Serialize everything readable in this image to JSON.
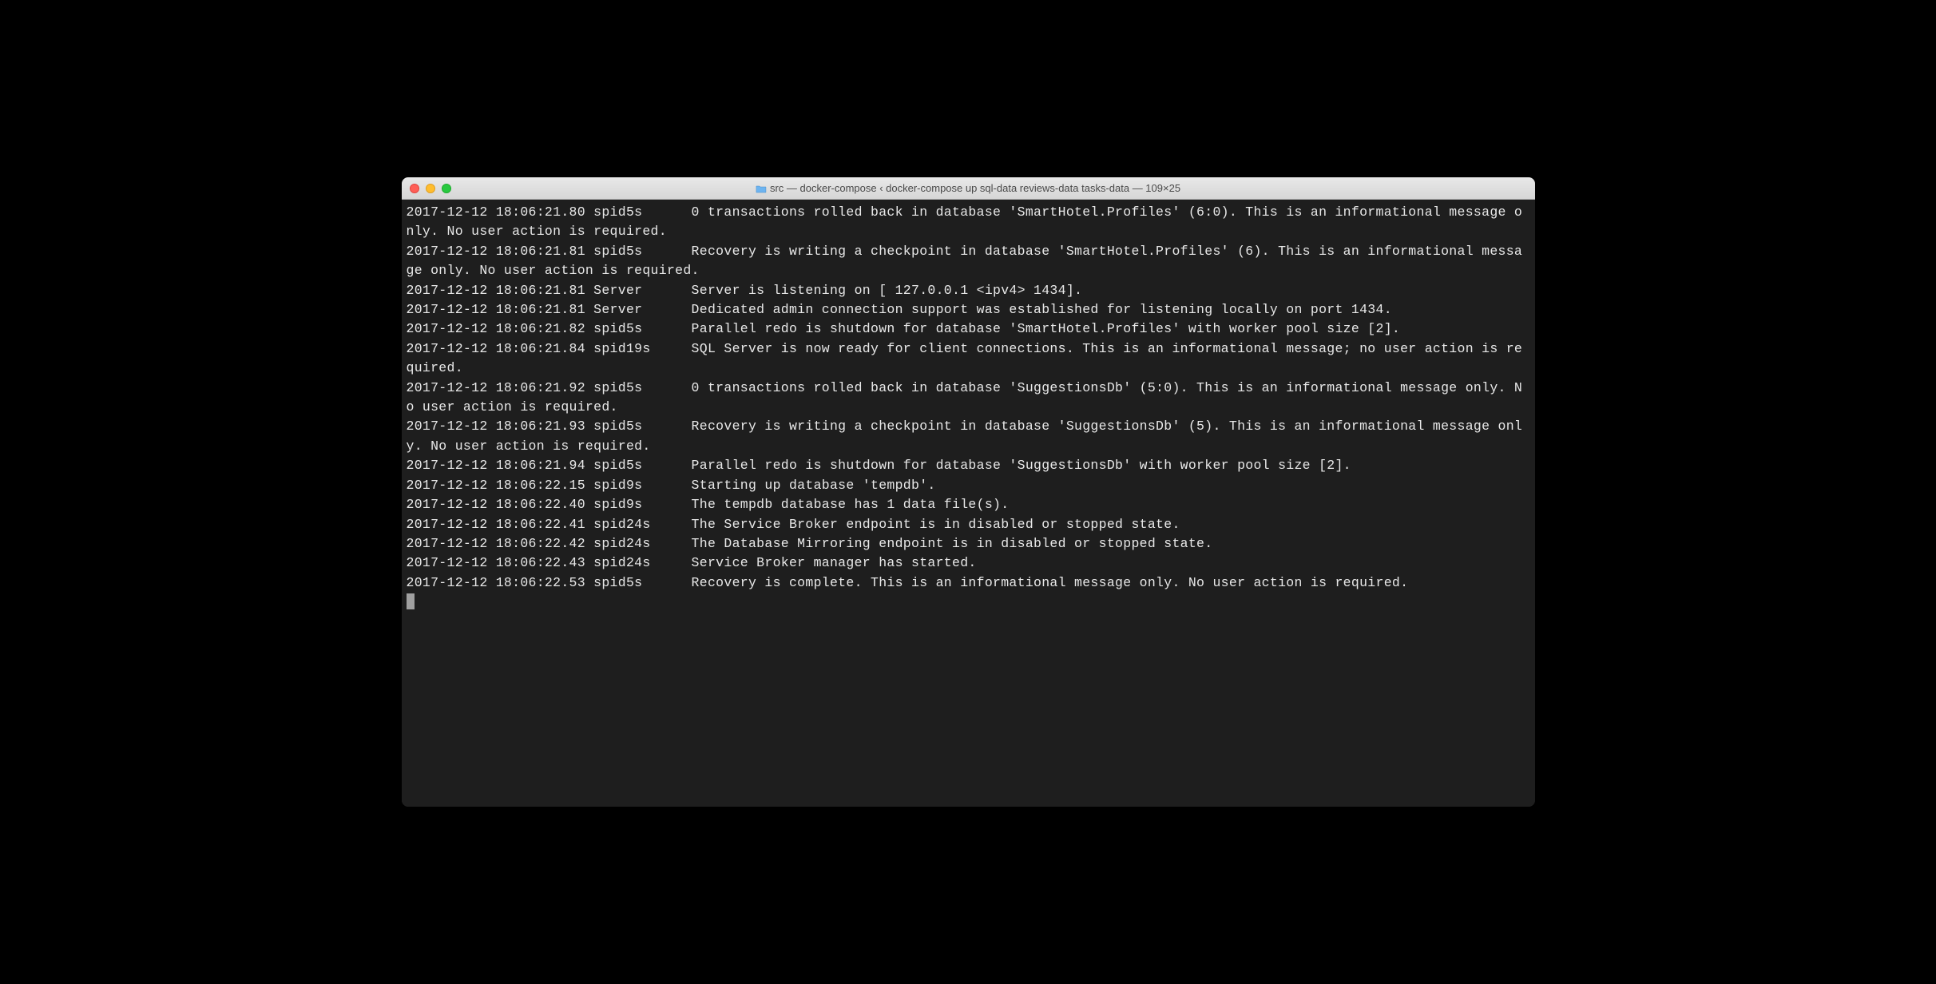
{
  "window": {
    "title": "src — docker-compose ‹ docker-compose up sql-data reviews-data tasks-data — 109×25"
  },
  "log_lines": [
    "2017-12-12 18:06:21.80 spid5s      0 transactions rolled back in database 'SmartHotel.Profiles' (6:0). This is an informational message only. No user action is required.",
    "2017-12-12 18:06:21.81 spid5s      Recovery is writing a checkpoint in database 'SmartHotel.Profiles' (6). This is an informational message only. No user action is required.",
    "2017-12-12 18:06:21.81 Server      Server is listening on [ 127.0.0.1 <ipv4> 1434].",
    "2017-12-12 18:06:21.81 Server      Dedicated admin connection support was established for listening locally on port 1434.",
    "2017-12-12 18:06:21.82 spid5s      Parallel redo is shutdown for database 'SmartHotel.Profiles' with worker pool size [2].",
    "2017-12-12 18:06:21.84 spid19s     SQL Server is now ready for client connections. This is an informational message; no user action is required.",
    "2017-12-12 18:06:21.92 spid5s      0 transactions rolled back in database 'SuggestionsDb' (5:0). This is an informational message only. No user action is required.",
    "2017-12-12 18:06:21.93 spid5s      Recovery is writing a checkpoint in database 'SuggestionsDb' (5). This is an informational message only. No user action is required.",
    "2017-12-12 18:06:21.94 spid5s      Parallel redo is shutdown for database 'SuggestionsDb' with worker pool size [2].",
    "2017-12-12 18:06:22.15 spid9s      Starting up database 'tempdb'.",
    "2017-12-12 18:06:22.40 spid9s      The tempdb database has 1 data file(s).",
    "2017-12-12 18:06:22.41 spid24s     The Service Broker endpoint is in disabled or stopped state.",
    "2017-12-12 18:06:22.42 spid24s     The Database Mirroring endpoint is in disabled or stopped state.",
    "2017-12-12 18:06:22.43 spid24s     Service Broker manager has started.",
    "2017-12-12 18:06:22.53 spid5s      Recovery is complete. This is an informational message only. No user action is required."
  ]
}
